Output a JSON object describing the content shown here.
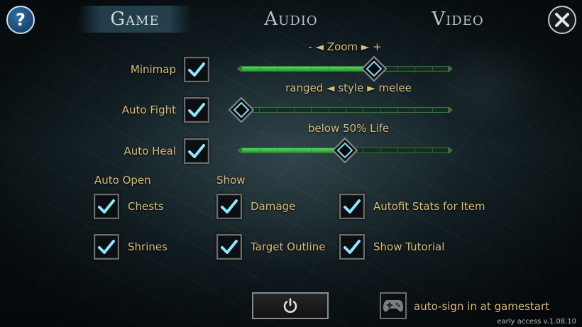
{
  "tabs": [
    {
      "label": "Game",
      "active": true
    },
    {
      "label": "Audio",
      "active": false
    },
    {
      "label": "Video",
      "active": false
    }
  ],
  "help_glyph": "?",
  "settings": {
    "minimap": {
      "label": "Minimap",
      "checked": true
    },
    "auto_fight": {
      "label": "Auto Fight",
      "checked": true
    },
    "auto_heal": {
      "label": "Auto Heal",
      "checked": true
    }
  },
  "sliders": {
    "zoom": {
      "caption": "- ◄ Zoom ► +",
      "value": 0.64
    },
    "style": {
      "caption": "ranged ◄ style ► melee",
      "value": 0.0
    },
    "life": {
      "caption": "below 50% Life",
      "value": 0.5
    }
  },
  "auto_open": {
    "heading": "Auto Open",
    "items": [
      {
        "label": "Chests",
        "checked": true
      },
      {
        "label": "Shrines",
        "checked": true
      }
    ]
  },
  "show": {
    "heading": "Show",
    "items": [
      {
        "label": "Damage",
        "checked": true
      },
      {
        "label": "Target Outline",
        "checked": true
      }
    ]
  },
  "extra": {
    "items": [
      {
        "label": "Autofit Stats for Item",
        "checked": true
      },
      {
        "label": "Show Tutorial",
        "checked": true
      }
    ]
  },
  "bottom": {
    "power_icon": "power-icon",
    "gamepad_icon": "gamepad-icon",
    "auto_sign_label": "auto-sign in at gamestart"
  },
  "version": "early access v.1.08.10",
  "colors": {
    "label_gold": "#d9ba7c",
    "check_cyan": "#8fe6ff",
    "slider_green": "#3ccc43"
  }
}
